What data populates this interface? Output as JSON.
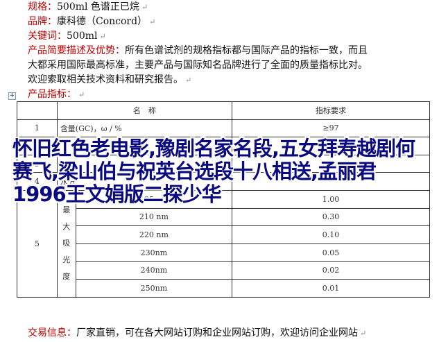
{
  "spec_label": "规格：",
  "spec_value": "500ml 色谱正已烷",
  "brand_label": "品牌：",
  "brand_value": "康科德（Concord）",
  "keyword_label": "关键词：",
  "keyword_value": "500ml",
  "desc_label": "产品简要描述及优势：",
  "desc_line1": "所有色谱试剂的规格指标都与国际产品的指标一致，而且",
  "desc_line2": "大都采用国际最高标准，主要产品与国际知名品牌进行了全面的质量指标比对。",
  "desc_line3": "欢迎索取相关技术资料和研究报告。",
  "index_label": "产品指标：",
  "paragraph_mark": "↵",
  "anchor_glyph": "+",
  "table": {
    "header_name": "名　称",
    "header_req": "指标要求",
    "rows_top": [
      {
        "no": "1",
        "name": "含量(GC)，ω / %",
        "req": "≥97"
      },
      {
        "no": "2",
        "name": "",
        "req": ""
      },
      {
        "no": "3",
        "name": "",
        "req": ""
      },
      {
        "no": "4",
        "name": "水分",
        "req": ""
      }
    ],
    "row5_no": "5",
    "row5_group": "最大吸光度",
    "absorbance": [
      {
        "wl": "195 nm",
        "val": "1.00"
      },
      {
        "wl": "210 nm",
        "val": "0.30"
      },
      {
        "wl": "220 nm",
        "val": "0.10"
      },
      {
        "wl": "230nm",
        "val": "0.05"
      },
      {
        "wl": "240nm",
        "val": "0.02"
      },
      {
        "wl": "250nm",
        "val": "0.01"
      }
    ]
  },
  "trade_label": "交易信息：",
  "trade_value": "厂家直销，可在各大网站订购和企业网站订购，欢迎访问企业网站",
  "overlay_text": "怀旧红色老电影,豫剧名家名段,五女拜寿越剧何赛飞,梁山伯与祝英台选段十八相送,孟丽君1996王文娟版二探少华"
}
